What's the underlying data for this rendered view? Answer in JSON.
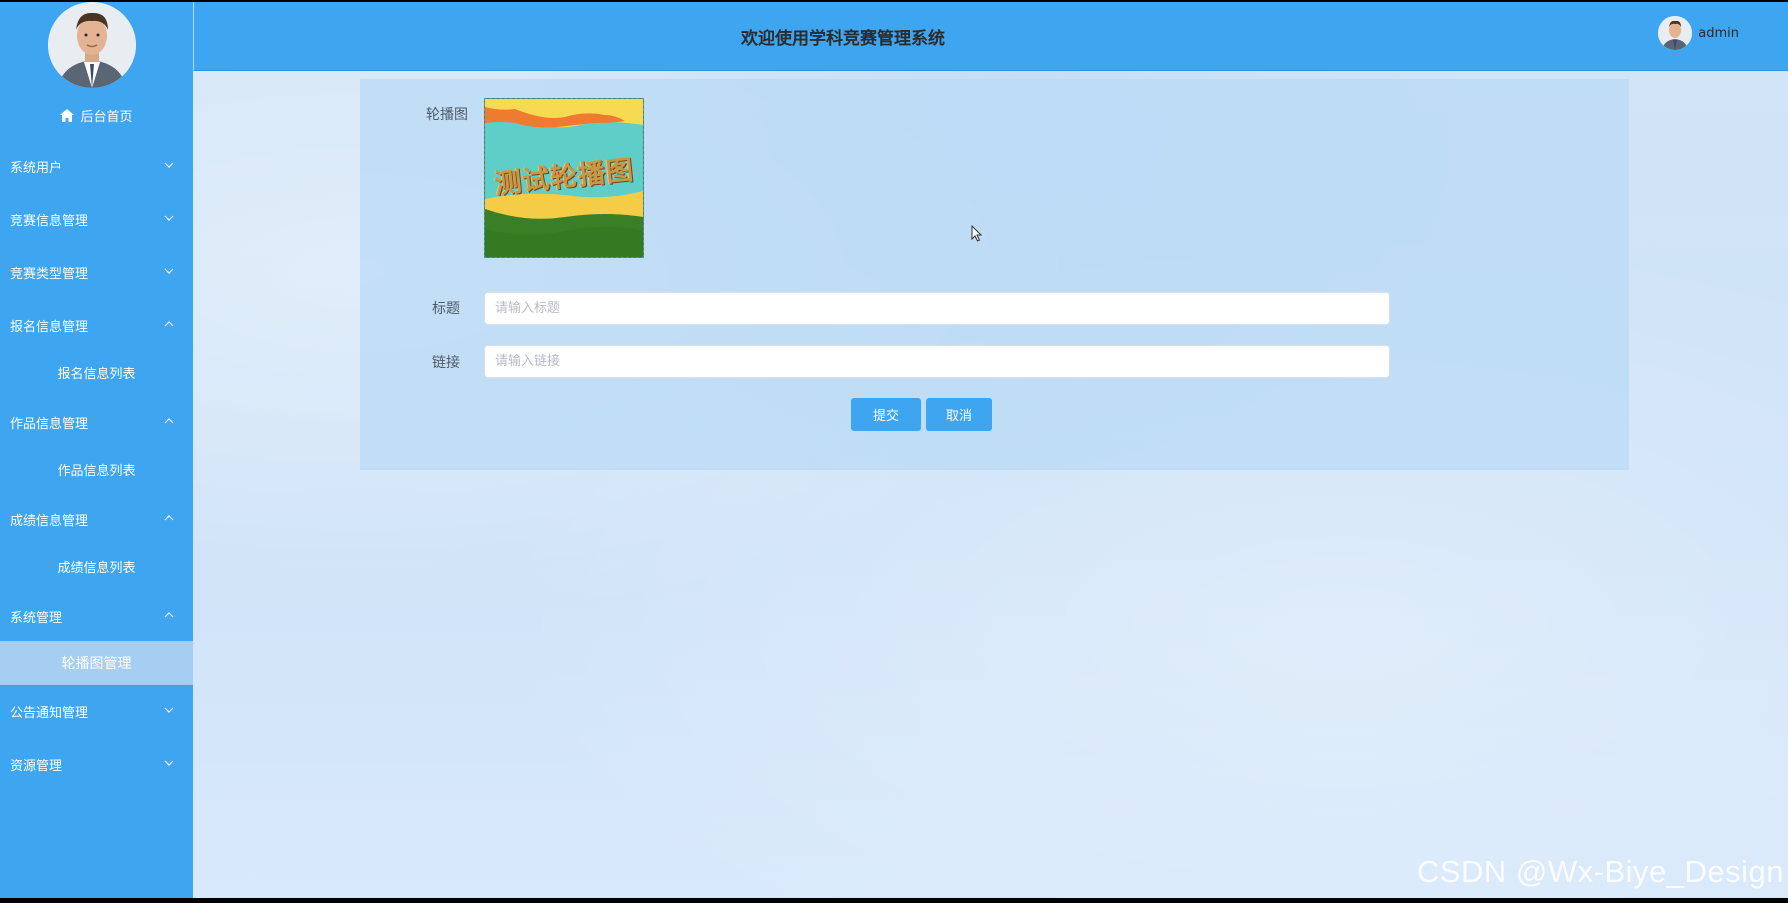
{
  "header": {
    "title": "欢迎使用学科竞赛管理系统",
    "username": "admin"
  },
  "sidebar": {
    "home_label": "后台首页",
    "menu": [
      {
        "label": "系统用户",
        "expanded": false
      },
      {
        "label": "竞赛信息管理",
        "expanded": false
      },
      {
        "label": "竞赛类型管理",
        "expanded": false
      },
      {
        "label": "报名信息管理",
        "expanded": true,
        "children": [
          "报名信息列表"
        ]
      },
      {
        "label": "作品信息管理",
        "expanded": true,
        "children": [
          "作品信息列表"
        ]
      },
      {
        "label": "成绩信息管理",
        "expanded": true,
        "children": [
          "成绩信息列表"
        ]
      },
      {
        "label": "系统管理",
        "expanded": true,
        "children": [
          "轮播图管理"
        ]
      },
      {
        "label": "公告通知管理",
        "expanded": false
      },
      {
        "label": "资源管理",
        "expanded": false
      }
    ],
    "active_item": "轮播图管理"
  },
  "form": {
    "carousel_label": "轮播图",
    "carousel_image_text": "测试轮播图",
    "title_label": "标题",
    "title_placeholder": "请输入标题",
    "link_label": "链接",
    "link_placeholder": "请输入链接",
    "submit_label": "提交",
    "cancel_label": "取消"
  },
  "watermark": "CSDN @Wx-Biye_Design",
  "colors": {
    "primary": "#3ea6f1",
    "active_menu_bg": "#a6cef3",
    "card_bg": "#b9d9f6"
  }
}
